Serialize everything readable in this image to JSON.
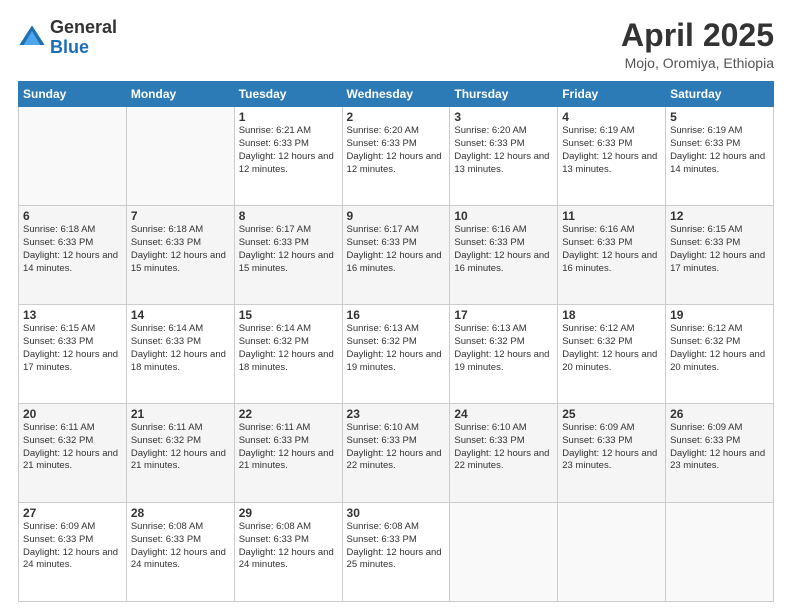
{
  "logo": {
    "general": "General",
    "blue": "Blue"
  },
  "header": {
    "title": "April 2025",
    "subtitle": "Mojo, Oromiya, Ethiopia"
  },
  "days_of_week": [
    "Sunday",
    "Monday",
    "Tuesday",
    "Wednesday",
    "Thursday",
    "Friday",
    "Saturday"
  ],
  "weeks": [
    [
      {
        "day": "",
        "info": ""
      },
      {
        "day": "",
        "info": ""
      },
      {
        "day": "1",
        "info": "Sunrise: 6:21 AM\nSunset: 6:33 PM\nDaylight: 12 hours and 12 minutes."
      },
      {
        "day": "2",
        "info": "Sunrise: 6:20 AM\nSunset: 6:33 PM\nDaylight: 12 hours and 12 minutes."
      },
      {
        "day": "3",
        "info": "Sunrise: 6:20 AM\nSunset: 6:33 PM\nDaylight: 12 hours and 13 minutes."
      },
      {
        "day": "4",
        "info": "Sunrise: 6:19 AM\nSunset: 6:33 PM\nDaylight: 12 hours and 13 minutes."
      },
      {
        "day": "5",
        "info": "Sunrise: 6:19 AM\nSunset: 6:33 PM\nDaylight: 12 hours and 14 minutes."
      }
    ],
    [
      {
        "day": "6",
        "info": "Sunrise: 6:18 AM\nSunset: 6:33 PM\nDaylight: 12 hours and 14 minutes."
      },
      {
        "day": "7",
        "info": "Sunrise: 6:18 AM\nSunset: 6:33 PM\nDaylight: 12 hours and 15 minutes."
      },
      {
        "day": "8",
        "info": "Sunrise: 6:17 AM\nSunset: 6:33 PM\nDaylight: 12 hours and 15 minutes."
      },
      {
        "day": "9",
        "info": "Sunrise: 6:17 AM\nSunset: 6:33 PM\nDaylight: 12 hours and 16 minutes."
      },
      {
        "day": "10",
        "info": "Sunrise: 6:16 AM\nSunset: 6:33 PM\nDaylight: 12 hours and 16 minutes."
      },
      {
        "day": "11",
        "info": "Sunrise: 6:16 AM\nSunset: 6:33 PM\nDaylight: 12 hours and 16 minutes."
      },
      {
        "day": "12",
        "info": "Sunrise: 6:15 AM\nSunset: 6:33 PM\nDaylight: 12 hours and 17 minutes."
      }
    ],
    [
      {
        "day": "13",
        "info": "Sunrise: 6:15 AM\nSunset: 6:33 PM\nDaylight: 12 hours and 17 minutes."
      },
      {
        "day": "14",
        "info": "Sunrise: 6:14 AM\nSunset: 6:33 PM\nDaylight: 12 hours and 18 minutes."
      },
      {
        "day": "15",
        "info": "Sunrise: 6:14 AM\nSunset: 6:32 PM\nDaylight: 12 hours and 18 minutes."
      },
      {
        "day": "16",
        "info": "Sunrise: 6:13 AM\nSunset: 6:32 PM\nDaylight: 12 hours and 19 minutes."
      },
      {
        "day": "17",
        "info": "Sunrise: 6:13 AM\nSunset: 6:32 PM\nDaylight: 12 hours and 19 minutes."
      },
      {
        "day": "18",
        "info": "Sunrise: 6:12 AM\nSunset: 6:32 PM\nDaylight: 12 hours and 20 minutes."
      },
      {
        "day": "19",
        "info": "Sunrise: 6:12 AM\nSunset: 6:32 PM\nDaylight: 12 hours and 20 minutes."
      }
    ],
    [
      {
        "day": "20",
        "info": "Sunrise: 6:11 AM\nSunset: 6:32 PM\nDaylight: 12 hours and 21 minutes."
      },
      {
        "day": "21",
        "info": "Sunrise: 6:11 AM\nSunset: 6:32 PM\nDaylight: 12 hours and 21 minutes."
      },
      {
        "day": "22",
        "info": "Sunrise: 6:11 AM\nSunset: 6:33 PM\nDaylight: 12 hours and 21 minutes."
      },
      {
        "day": "23",
        "info": "Sunrise: 6:10 AM\nSunset: 6:33 PM\nDaylight: 12 hours and 22 minutes."
      },
      {
        "day": "24",
        "info": "Sunrise: 6:10 AM\nSunset: 6:33 PM\nDaylight: 12 hours and 22 minutes."
      },
      {
        "day": "25",
        "info": "Sunrise: 6:09 AM\nSunset: 6:33 PM\nDaylight: 12 hours and 23 minutes."
      },
      {
        "day": "26",
        "info": "Sunrise: 6:09 AM\nSunset: 6:33 PM\nDaylight: 12 hours and 23 minutes."
      }
    ],
    [
      {
        "day": "27",
        "info": "Sunrise: 6:09 AM\nSunset: 6:33 PM\nDaylight: 12 hours and 24 minutes."
      },
      {
        "day": "28",
        "info": "Sunrise: 6:08 AM\nSunset: 6:33 PM\nDaylight: 12 hours and 24 minutes."
      },
      {
        "day": "29",
        "info": "Sunrise: 6:08 AM\nSunset: 6:33 PM\nDaylight: 12 hours and 24 minutes."
      },
      {
        "day": "30",
        "info": "Sunrise: 6:08 AM\nSunset: 6:33 PM\nDaylight: 12 hours and 25 minutes."
      },
      {
        "day": "",
        "info": ""
      },
      {
        "day": "",
        "info": ""
      },
      {
        "day": "",
        "info": ""
      }
    ]
  ]
}
